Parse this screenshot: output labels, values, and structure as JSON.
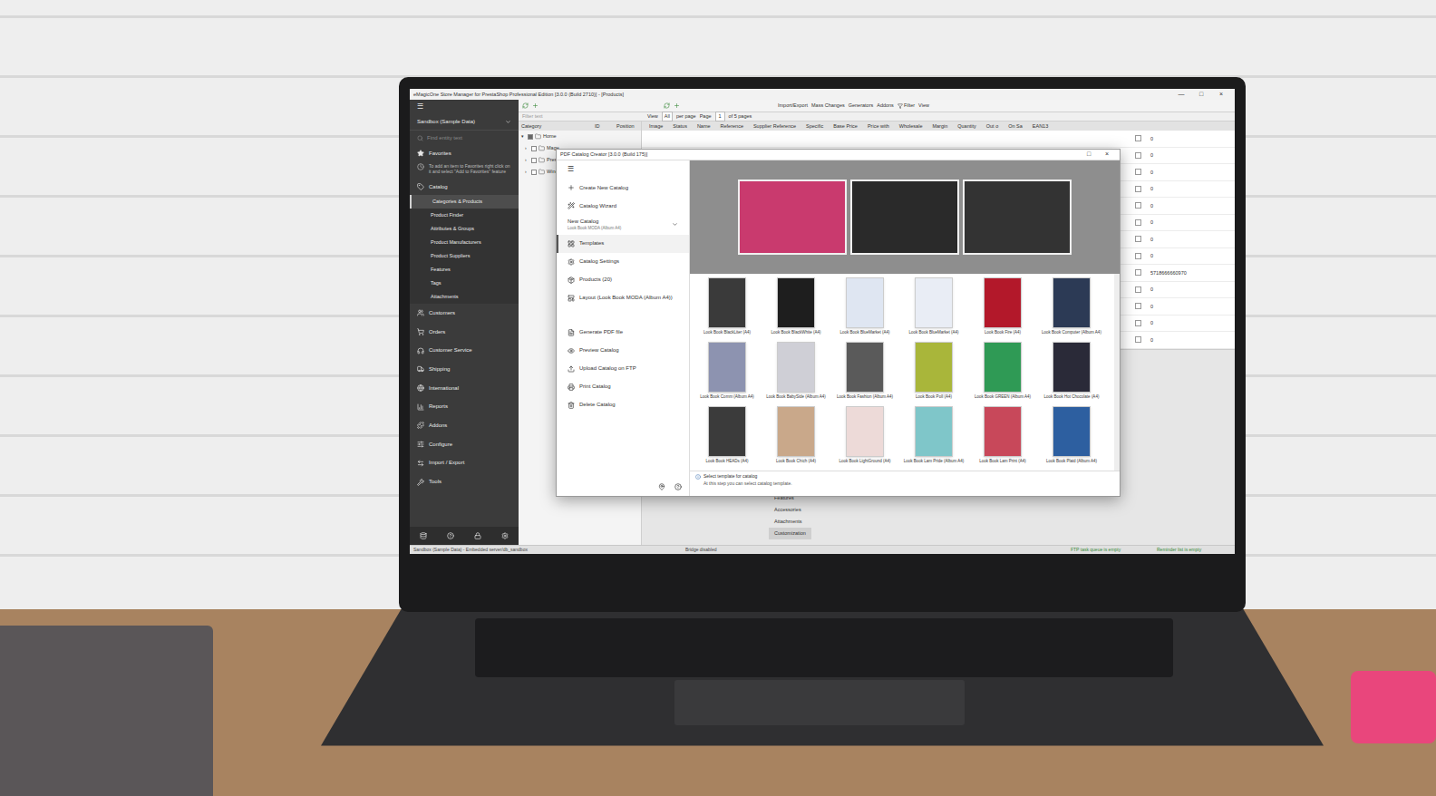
{
  "window": {
    "title": "eMagicOne Store Manager for PrestaShop Professional Edition [3.0.0 (Build 2710)] - [Products]",
    "controls": [
      "—",
      "□",
      "×"
    ]
  },
  "sidebar": {
    "menu": "☰",
    "profile": "Sandbox (Sample Data)",
    "search_placeholder": "Find entity text",
    "favorites": "Favorites",
    "favorites_hint": "To add an item to Favorites right click on it and select \"Add to Favorites\" feature",
    "catalog": "Catalog",
    "catalog_items": [
      {
        "label": "Categories & Products",
        "selected": true
      },
      {
        "label": "Product Finder",
        "selected": false
      },
      {
        "label": "Attributes & Groups",
        "selected": false
      },
      {
        "label": "Product Manufacturers",
        "selected": false
      },
      {
        "label": "Product Suppliers",
        "selected": false
      },
      {
        "label": "Features",
        "selected": false
      },
      {
        "label": "Tags",
        "selected": false
      },
      {
        "label": "Attachments",
        "selected": false
      }
    ],
    "sections": [
      "Customers",
      "Orders",
      "Customer Service",
      "Shipping",
      "International",
      "Reports",
      "Addons",
      "Configure",
      "Import / Export",
      "Tools"
    ]
  },
  "toolbar": {
    "buttons": [
      "Import/Export",
      "Mass Changes",
      "Generators",
      "Addons",
      "Filter",
      "View"
    ],
    "filter_placeholder": "Filter text",
    "view_label": "View",
    "view_value": "All",
    "per_page": "per page",
    "page_label": "Page",
    "page_value": "1",
    "of_pages": "of 5 pages"
  },
  "categories": {
    "columns": [
      "Category",
      "ID",
      "Position"
    ],
    "items": [
      {
        "label": "Home",
        "expanded": true,
        "checked": true,
        "level": 0
      },
      {
        "label": "Mage",
        "expanded": false,
        "checked": false,
        "level": 1
      },
      {
        "label": "Presta",
        "expanded": false,
        "checked": false,
        "level": 1
      },
      {
        "label": "Wine C",
        "expanded": false,
        "checked": false,
        "level": 1
      }
    ]
  },
  "grid": {
    "columns": [
      "Image",
      "Status",
      "Name",
      "Reference",
      "Supplier Reference",
      "Specific",
      "Base Price",
      "Price with",
      "Wholesale",
      "Margin",
      "Quantity",
      "Out o",
      "On Sa",
      "EAN13"
    ],
    "rows": [
      {
        "checked": false,
        "value": "0"
      },
      {
        "checked": false,
        "value": "0"
      },
      {
        "checked": false,
        "value": "0"
      },
      {
        "checked": false,
        "value": "0"
      },
      {
        "checked": false,
        "value": "0"
      },
      {
        "checked": false,
        "value": "0"
      },
      {
        "checked": false,
        "value": "0"
      },
      {
        "checked": false,
        "value": "0"
      },
      {
        "checked": false,
        "value": "5718666660970"
      },
      {
        "checked": false,
        "value": "0"
      },
      {
        "checked": false,
        "value": "0"
      },
      {
        "checked": false,
        "value": "0"
      },
      {
        "checked": false,
        "value": "0"
      }
    ]
  },
  "detail_tabs": [
    {
      "label": "Features",
      "selected": false
    },
    {
      "label": "Accessories",
      "selected": false
    },
    {
      "label": "Attachments",
      "selected": false
    },
    {
      "label": "Customization",
      "selected": true
    }
  ],
  "status_bar": [
    "Sandbox (Sample Data) - Embedded server/db_sandbox",
    "Bridge disabled",
    "FTP task queue is empty",
    "Reminder list is empty"
  ],
  "dialog": {
    "title": "PDF Catalog Creator [3.0.0 (Build 175)]",
    "controls": [
      "□",
      "×"
    ],
    "menu": "☰",
    "top_items": [
      "Create New Catalog",
      "Catalog Wizard"
    ],
    "catalog": {
      "name": "New Catalog",
      "subtitle": "Look Book MODA (Album A4)"
    },
    "steps": [
      {
        "label": "Templates",
        "selected": true
      },
      {
        "label": "Catalog Settings",
        "selected": false
      },
      {
        "label": "Products (20)",
        "selected": false
      },
      {
        "label": "Layout (Look Book MODA (Album A4))",
        "selected": false
      }
    ],
    "actions": [
      "Generate PDF file",
      "Preview Catalog",
      "Upload Catalog on FTP",
      "Print Catalog",
      "Delete Catalog"
    ],
    "preview_pages": [
      {
        "color": "#c93a6e"
      },
      {
        "color": "#2a2a2a"
      },
      {
        "color": "#333333"
      }
    ],
    "templates": [
      {
        "label": "Look Book BlackLiter (A4)",
        "color": "#3a3a3a",
        "selected": false
      },
      {
        "label": "Look Book BlackWhite (A4)",
        "color": "#1e1e1e",
        "selected": false
      },
      {
        "label": "Look Book BlueMarket (A4)",
        "color": "#dfe6f2",
        "selected": false
      },
      {
        "label": "Look Book BlueMarket (A4)",
        "color": "#e9edf5",
        "selected": false
      },
      {
        "label": "Look Book Fire (A4)",
        "color": "#b3182a",
        "selected": false
      },
      {
        "label": "Look Book Computer (Album A4)",
        "color": "#2c3a55",
        "selected": false
      },
      {
        "label": "Look Book Comm (Album A4)",
        "color": "#8d93b0",
        "selected": false
      },
      {
        "label": "Look Book BabySide (Album A4)",
        "color": "#cfcfd6",
        "selected": false
      },
      {
        "label": "Look Book Fashion (Album A4)",
        "color": "#5a5a5a",
        "selected": false
      },
      {
        "label": "Look Book Poll (A4)",
        "color": "#a9b63a",
        "selected": false
      },
      {
        "label": "Look Book GREEN (Album A4)",
        "color": "#2f9a55",
        "selected": false
      },
      {
        "label": "Look Book Hot Chocolate (A4)",
        "color": "#2a2a38",
        "selected": false
      },
      {
        "label": "Look Book HEADs (A4)",
        "color": "#3b3b3b",
        "selected": false
      },
      {
        "label": "Look Book Chich (A4)",
        "color": "#c9a88a",
        "selected": false
      },
      {
        "label": "Look Book LightGround (A4)",
        "color": "#eddad8",
        "selected": false
      },
      {
        "label": "Look Book Lam Pride (Album A4)",
        "color": "#7fc6c9",
        "selected": false
      },
      {
        "label": "Look Book Lam Print (A4)",
        "color": "#c8485a",
        "selected": false
      },
      {
        "label": "Look Book Plaid (Album A4)",
        "color": "#2d5fa0",
        "selected": false
      }
    ],
    "hint_title": "Select template for catalog",
    "hint_text": "At this step you can select catalog template."
  }
}
